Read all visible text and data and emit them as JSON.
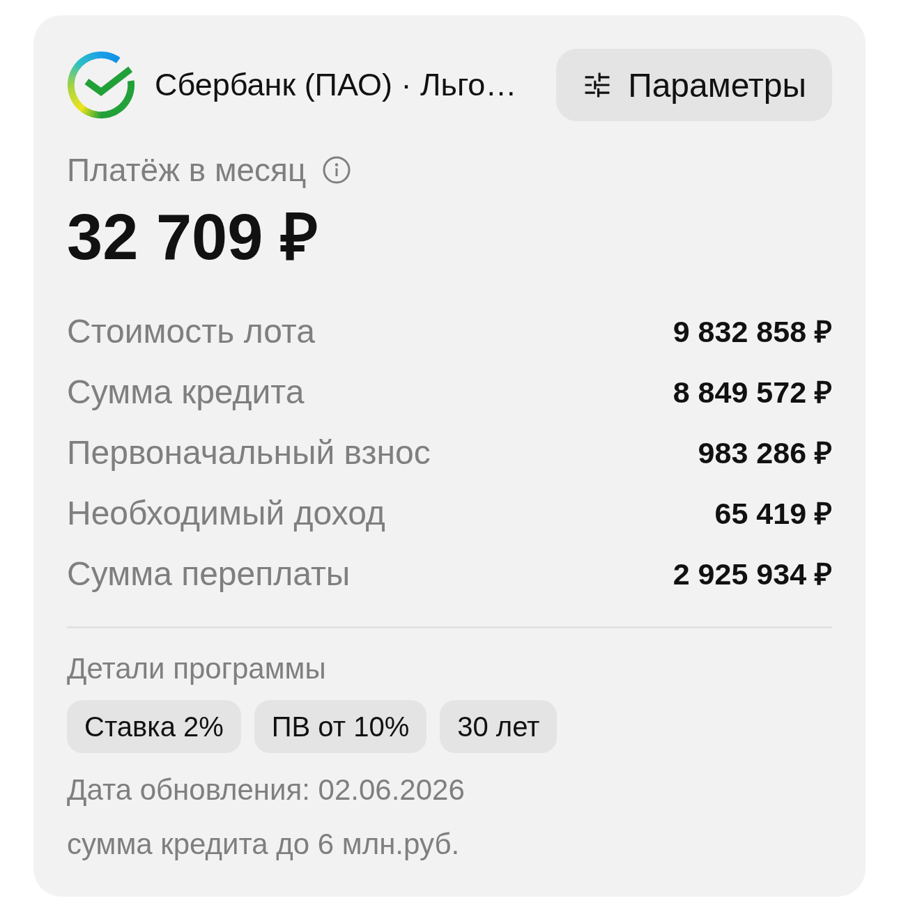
{
  "header": {
    "title": "Сбербанк (ПАО) · Льго…",
    "button": "Параметры"
  },
  "payment": {
    "label": "Платёж в месяц",
    "amount": "32 709 ₽"
  },
  "details": [
    {
      "label": "Стоимость лота",
      "value": "9 832 858 ₽"
    },
    {
      "label": "Сумма кредита",
      "value": "8 849 572 ₽"
    },
    {
      "label": "Первоначальный взнос",
      "value": "983 286 ₽"
    },
    {
      "label": "Необходимый доход",
      "value": "65 419 ₽"
    },
    {
      "label": "Сумма переплаты",
      "value": "2 925 934 ₽"
    }
  ],
  "program": {
    "title": "Детали программы",
    "tags": [
      "Ставка 2%",
      "ПВ от 10%",
      "30 лет"
    ],
    "updated": "Дата обновления: 02.06.2026",
    "note": "сумма кредита до 6 млн.руб."
  }
}
